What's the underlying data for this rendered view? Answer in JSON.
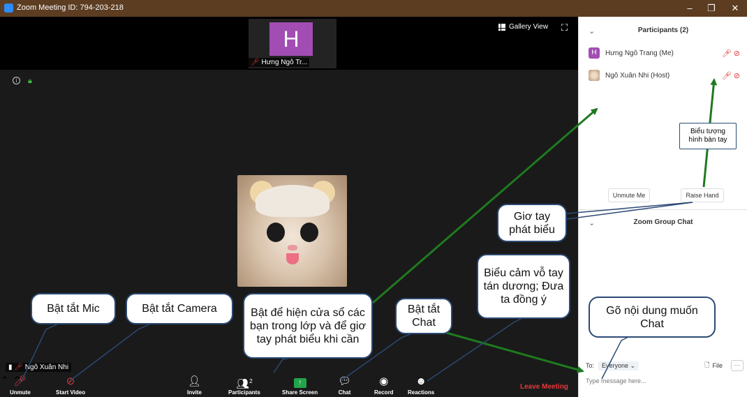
{
  "window": {
    "title": "Zoom Meeting ID: 794-203-218",
    "minimize": "–",
    "restore": "❐",
    "close": "✕"
  },
  "video": {
    "thumbnail_initial": "H",
    "thumbnail_name": "Hưng Ngô Tr...",
    "gallery_view_label": "Gallery View",
    "self_name": "Ngô Xuân Nhi"
  },
  "toolbar": {
    "unmute_label": "Unmute",
    "start_video_label": "Start Video",
    "invite_label": "Invite",
    "participants_label": "Participants",
    "participants_count": "2",
    "share_screen_label": "Share Screen",
    "chat_label": "Chat",
    "record_label": "Record",
    "reactions_label": "Reactions",
    "leave_label": "Leave Meeting"
  },
  "participants_panel": {
    "title": "Participants (2)",
    "participants": [
      {
        "initial": "H",
        "name": "Hưng Ngô Trang (Me)"
      },
      {
        "initial": "",
        "name": "Ngô Xuân Nhi (Host)"
      }
    ],
    "unmute_me_label": "Unmute Me",
    "raise_hand_label": "Raise Hand"
  },
  "chat_panel": {
    "title": "Zoom Group Chat",
    "to_label": "To:",
    "recipient": "Everyone",
    "file_label": "File",
    "more_label": "···",
    "input_placeholder": "Type message here..."
  },
  "annotations": {
    "mic": "Bật tắt Mic",
    "camera": "Bật tắt Camera",
    "participants": "Bật để hiện cửa sổ các bạn trong lớp và để giơ tay phát biểu khi cần",
    "chat": "Bật tắt Chat",
    "reactions": "Biểu cảm vỗ tay tán dương; Đưa ta đồng ý",
    "type_chat": "Gõ nội dung muốn Chat",
    "raise_hand": "Giơ tay phát biểu",
    "hand_icon": "Biểu tượng hình bàn tay"
  },
  "colors": {
    "titlebar": "#5c3d22",
    "leave_red": "#e43a3a",
    "arrow_green": "#1f7a1f",
    "bubble_border": "#2b4a73",
    "avatar_purple": "#a24db3"
  }
}
